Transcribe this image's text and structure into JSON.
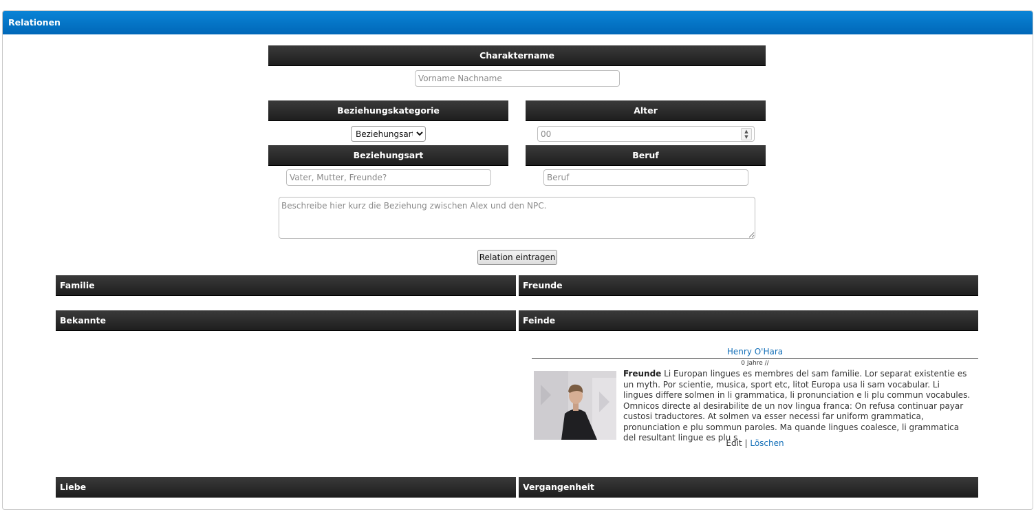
{
  "panel": {
    "title": "Relationen"
  },
  "form": {
    "charaktername_label": "Charaktername",
    "name_placeholder": "Vorname Nachname",
    "beziehungskategorie_label": "Beziehungskategorie",
    "kategorie_selected": "Beziehungsart",
    "alter_label": "Alter",
    "alter_placeholder": "00",
    "beziehungsart_label": "Beziehungsart",
    "beziehungsart_placeholder": "Vater, Mutter, Freunde?",
    "beruf_label": "Beruf",
    "beruf_placeholder": "Beruf",
    "beschreibung_placeholder": "Beschreibe hier kurz die Beziehung zwischen Alex und den NPC.",
    "submit_label": "Relation eintragen"
  },
  "categories": {
    "familie": "Familie",
    "freunde": "Freunde",
    "bekannte": "Bekannte",
    "feinde": "Feinde",
    "liebe": "Liebe",
    "vergangenheit": "Vergangenheit"
  },
  "entry": {
    "name": "Henry O'Hara",
    "meta": "0 Jahre //",
    "relation": "Freunde",
    "description": "Li Europan lingues es membres del sam familie. Lor separat existentie es un myth. Por scientie, musica, sport etc, litot Europa usa li sam vocabular. Li lingues differe solmen in li grammatica, li pronunciation e li plu commun vocabules. Omnicos directe al desirabilite de un nov lingua franca: On refusa continuar payar custosi traductores. At solmen va esser necessi far uniform grammatica, pronunciation e plu sommun paroles. Ma quande lingues coalesce, li grammatica del resultant lingue es plu s",
    "edit_label": "Edit",
    "separator": "|",
    "delete_label": "Löschen"
  },
  "colors": {
    "header_blue": "#0a7fd2",
    "bar_dark": "#2a2a2a",
    "link_blue": "#1570b8"
  }
}
